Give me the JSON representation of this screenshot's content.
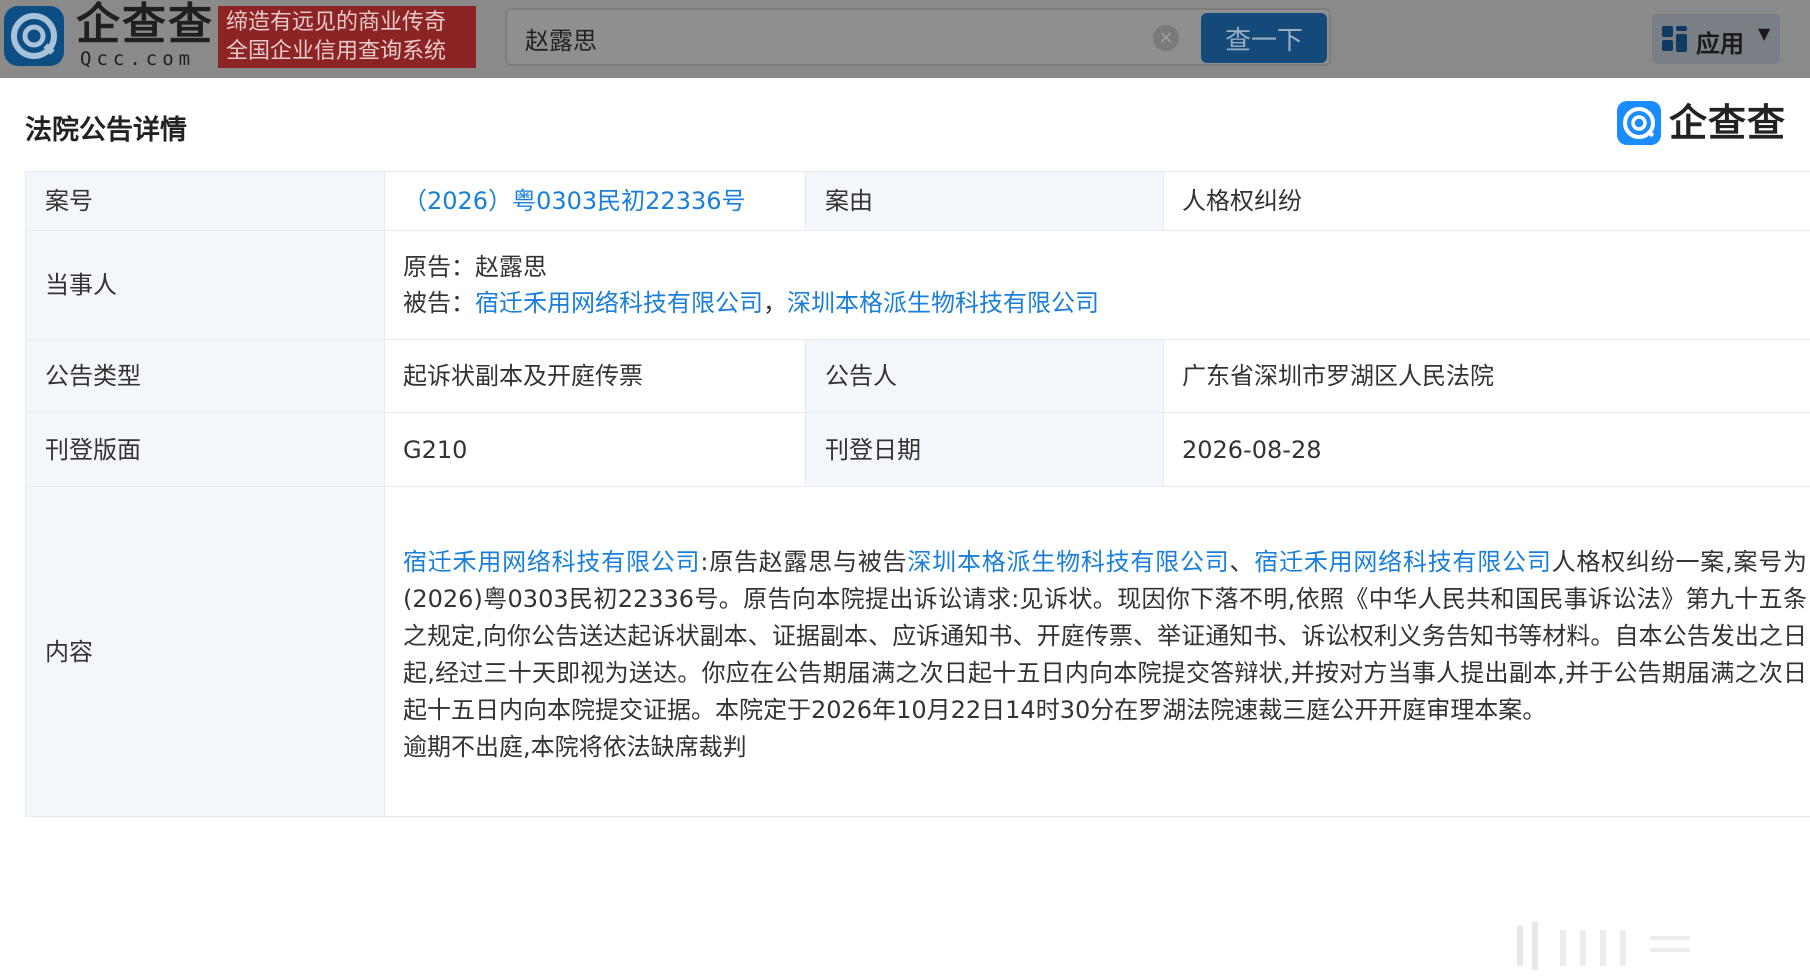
{
  "header": {
    "logo_text": "企查查",
    "logo_sub": "Qcc.com",
    "slogan_line1": "缔造有远见的商业传奇",
    "slogan_line2": "全国企业信用查询系统",
    "search_value": "赵露思",
    "search_button": "查一下",
    "apps_label": "应用"
  },
  "page": {
    "title": "法院公告详情",
    "brand_text": "企查查"
  },
  "rows": {
    "case_no_label": "案号",
    "case_no": "（2026）粤0303民初22336号",
    "cause_label": "案由",
    "cause": "人格权纠纷",
    "party_label": "当事人",
    "plaintiff_prefix": "原告：",
    "plaintiff": "赵露思",
    "defendant_prefix": "被告：",
    "defendant_1": "宿迁禾用网络科技有限公司",
    "defendant_sep": "，",
    "defendant_2": "深圳本格派生物科技有限公司",
    "type_label": "公告类型",
    "type": "起诉状副本及开庭传票",
    "announcer_label": "公告人",
    "announcer": "广东省深圳市罗湖区人民法院",
    "page_label": "刊登版面",
    "page_value": "G210",
    "date_label": "刊登日期",
    "date_value": "2026-08-28",
    "content_label": "内容",
    "content_link_1": "宿迁禾用网络科技有限公司",
    "content_text_1": ":原告赵露思与被告",
    "content_link_2": "深圳本格派生物科技有限公司",
    "content_text_2": "、",
    "content_link_3": "宿迁禾用网络科技有限公司",
    "content_text_3": "人格权纠纷一案,案号为(2026)粤0303民初22336号。原告向本院提出诉讼请求:见诉状。现因你下落不明,依照《中华人民共和国民事诉讼法》第九十五条之规定,向你公告送达起诉状副本、证据副本、应诉通知书、开庭传票、举证通知书、诉讼权利义务告知书等材料。自本公告发出之日起,经过三十天即视为送达。你应在公告期届满之次日起十五日内向本院提交答辩状,并按对方当事人提出副本,并于公告期届满之次日起十五日内向本院提交证据。本院定于2026年10月22日14时30分在罗湖法院速裁三庭公开开庭审理本案。",
    "content_text_4": "逾期不出庭,本院将依法缺席裁判"
  }
}
